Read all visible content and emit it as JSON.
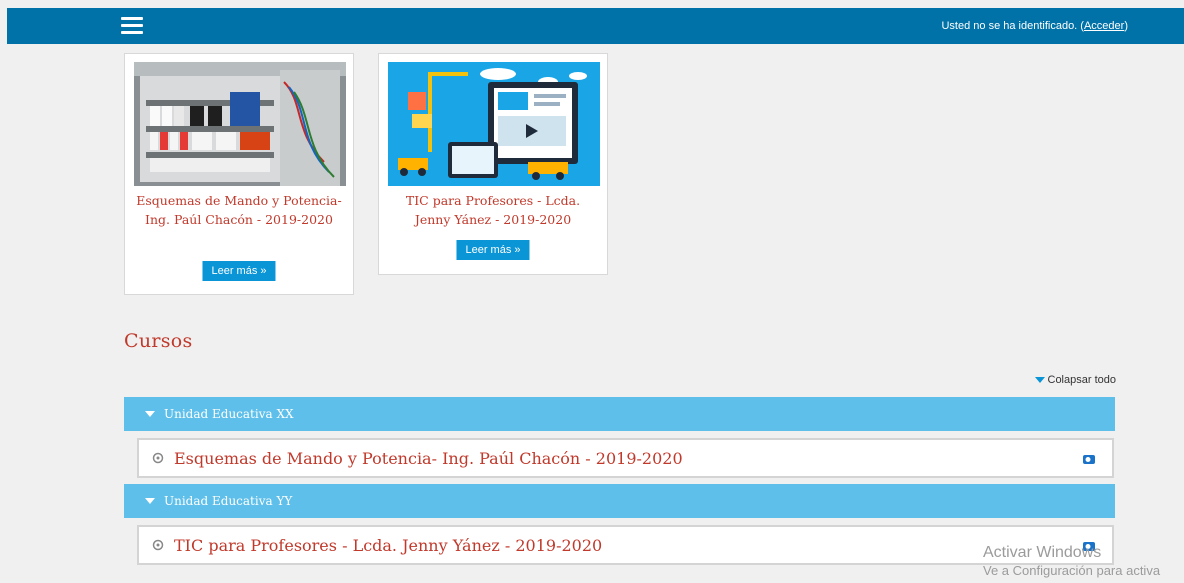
{
  "header": {
    "menu_icon": "hamburger-icon",
    "login_text": "Usted no se ha identificado. (",
    "login_link": "Acceder",
    "login_close": ")"
  },
  "featured": [
    {
      "title": "Esquemas de Mando y Potencia- Ing. Paúl Chacón - 2019-2020",
      "image": "electrical-panel-image",
      "button": "Leer más »"
    },
    {
      "title": "TIC para Profesores - Lcda. Jenny Yánez - 2019-2020",
      "image": "digital-tech-illustration",
      "button": "Leer más »"
    }
  ],
  "courses": {
    "title": "Cursos",
    "collapse_label": "Colapsar todo",
    "categories": [
      {
        "name": "Unidad Educativa XX",
        "course": "Esquemas de Mando y Potencia- Ing. Paúl Chacón - 2019-2020"
      },
      {
        "name": "Unidad Educativa YY",
        "course": "TIC para Profesores - Lcda. Jenny Yánez - 2019-2020"
      }
    ]
  },
  "watermark": {
    "line1": "Activar Windows",
    "line2": "Ve a Configuración para activa"
  },
  "colors": {
    "topbar": "#0072a8",
    "accent_red": "#c0392b",
    "category_bar": "#5ebfea",
    "button_blue": "#0a95d6"
  }
}
